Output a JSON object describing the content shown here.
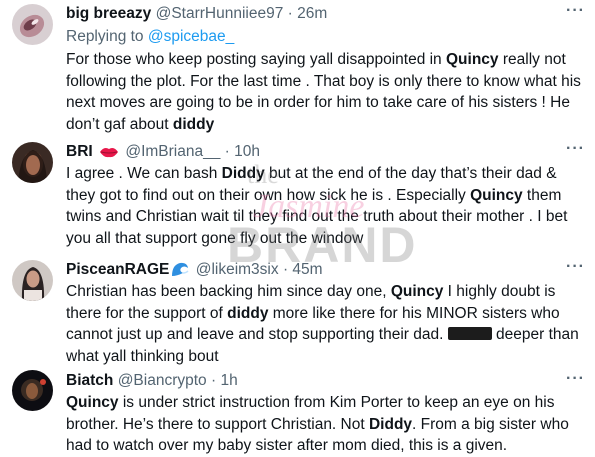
{
  "tweets": [
    {
      "name": "big breeazy",
      "handle": "@StarrHunniiee97",
      "sep": "·",
      "time": "26m",
      "reply_prefix": "Replying to",
      "reply_to": "@spicebae_",
      "body": [
        {
          "t": "For those who keep posting saying yall disappointed in "
        },
        {
          "t": "Quincy",
          "b": true
        },
        {
          "t": " really not following the plot. For the last time . That boy is only there to know what his next moves are going to be in order for him to take care of his sisters ! He don’t gaf about "
        },
        {
          "t": "diddy",
          "b": true
        }
      ]
    },
    {
      "name": "BRI",
      "emoji": "lips-icon",
      "handle": "@ImBriana__",
      "sep": "·",
      "time": "10h",
      "body": [
        {
          "t": "I agree . We can bash "
        },
        {
          "t": "Diddy",
          "b": true
        },
        {
          "t": " but at the end of the day that’s their dad & they got to find out on their own how sick he is . Especially "
        },
        {
          "t": "Quincy",
          "b": true
        },
        {
          "t": " them twins and Christian wait til they find out the truth about their mother . I bet you all that support gone fly out the window"
        }
      ]
    },
    {
      "name": "PisceanRAGE",
      "emoji": "wave-icon",
      "handle": "@likeim3six",
      "sep": "·",
      "time": "45m",
      "body": [
        {
          "t": "Christian has been backing him since day one, "
        },
        {
          "t": "Quincy",
          "b": true
        },
        {
          "t": " I highly doubt is there for the support of "
        },
        {
          "t": "diddy",
          "b": true
        },
        {
          "t": " more like there for his MINOR sisters who cannot just up and leave and stop supporting their dad. "
        },
        {
          "redact": true
        },
        {
          "t": " deeper than what yall thinking bout"
        }
      ]
    },
    {
      "name": "Biatch",
      "handle": "@Biancrypto",
      "sep": "·",
      "time": "1h",
      "body": [
        {
          "t": "Quincy",
          "b": true
        },
        {
          "t": " is under strict instruction from Kim Porter to keep an eye on his brother.  He’s there to support Christian.  Not "
        },
        {
          "t": "Diddy",
          "b": true
        },
        {
          "t": ".  From a big sister who had to watch over my baby sister after mom died, this is a given."
        }
      ]
    }
  ],
  "more_label": "···",
  "watermark": {
    "the": "the",
    "jasmine": "Jasmine",
    "brand": "BRAND"
  },
  "colors": {
    "handle": "#536471",
    "link": "#1d9bf0",
    "text": "#0f1419"
  }
}
